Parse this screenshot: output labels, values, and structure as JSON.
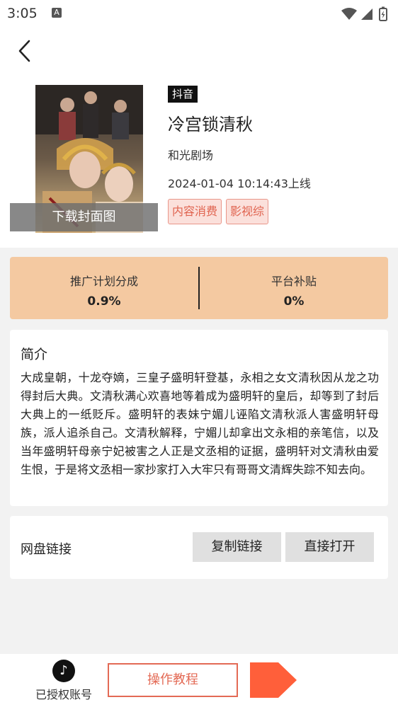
{
  "status_bar": {
    "time": "3:05",
    "a_icon": "A"
  },
  "drama": {
    "platform": "抖音",
    "title": "冷宫锁清秋",
    "producer": "和光剧场",
    "online_time": "2024-01-04 10:14:43上线",
    "download_cover_label": "下载封面图",
    "tags": [
      "内容消费",
      "影视综"
    ]
  },
  "stats": {
    "commission_label": "推广计划分成",
    "commission_value": "0.9%",
    "subsidy_label": "平台补贴",
    "subsidy_value": "0%"
  },
  "intro": {
    "title": "简介",
    "text": "大成皇朝，十龙夺嫡，三皇子盛明轩登基，永相之女文清秋因从龙之功得封后大典。文清秋满心欢喜地等着成为盛明轩的皇后，却等到了封后大典上的一纸贬斥。盛明轩的表妹宁媚儿诬陷文清秋派人害盛明轩母族，派人追杀自己。文清秋解释，宁媚儿却拿出文永相的亲笔信，以及当年盛明轩母亲宁妃被害之人正是文丞相的证据，盛明轩对文清秋由爱生恨，于是将文丞相一家抄家打入大牢只有哥哥文清辉失踪不知去向。"
  },
  "link_section": {
    "label": "网盘链接",
    "copy_label": "复制链接",
    "open_label": "直接打开"
  },
  "bottom_bar": {
    "authorized_label": "已授权账号",
    "tutorial_label": "操作教程"
  },
  "colors": {
    "accent": "#e36a55",
    "stats_bg": "#f4c9a1",
    "tag_bg": "#fbe0db"
  }
}
